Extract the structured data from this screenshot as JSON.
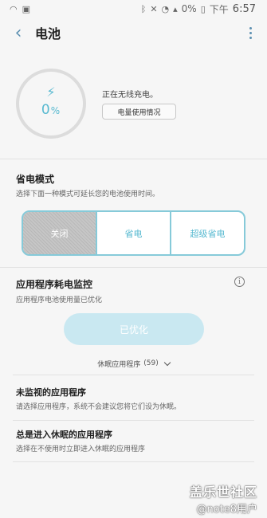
{
  "status_bar": {
    "battery_text": "0%",
    "time_prefix": "下午",
    "time": "6:57"
  },
  "app_bar": {
    "title": "电池",
    "back_icon": "back-arrow-icon",
    "overflow_icon": "more-vertical-icon"
  },
  "battery": {
    "percent_value": "0",
    "percent_sign": "%",
    "icon": "charging-bolt-icon",
    "status": "正在无线充电。",
    "usage_button": "电量使用情况"
  },
  "power_saving": {
    "title": "省电模式",
    "subtitle": "选择下面一种模式可延长您的电池使用时间。",
    "options": [
      "关闭",
      "省电",
      "超级省电"
    ],
    "selected": "关闭"
  },
  "app_monitor": {
    "title": "应用程序耗电监控",
    "subtitle": "应用程序电池使用量已优化",
    "button": "已优化",
    "sleeping_apps_label": "休眠应用程序",
    "sleeping_apps_count": "(59)"
  },
  "list": [
    {
      "title": "未监视的应用程序",
      "subtitle": "请选择应用程序，系统不会建议您将它们设为休眠。"
    },
    {
      "title": "总是进入休眠的应用程序",
      "subtitle": "选择在不使用时立即进入休眠的应用程序"
    }
  ],
  "watermark": {
    "line1": "盖乐世社区",
    "line2": "@note8用户"
  },
  "colors": {
    "accent": "#57b9d0",
    "outline": "#86cad9",
    "button_disabled": "#c9e8f1"
  }
}
